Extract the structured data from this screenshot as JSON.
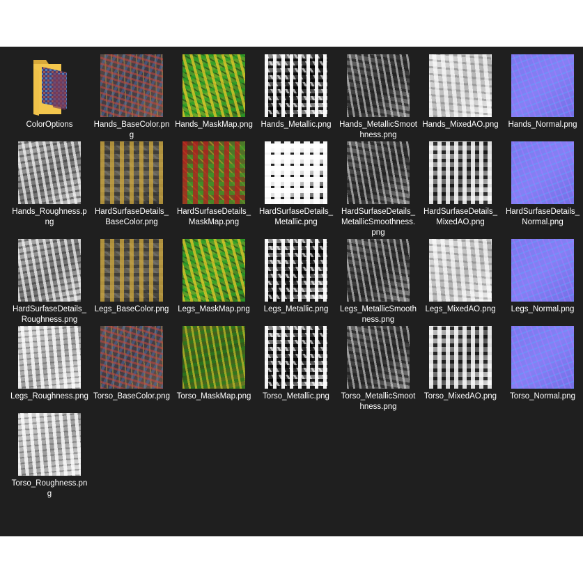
{
  "window": {
    "background": "#1f1f1f",
    "text_color": "#ffffff"
  },
  "folder": {
    "label": "ColorOptions",
    "icon": "folder-icon",
    "color": "#f3c64d"
  },
  "files": [
    {
      "label": "Hands_BaseColor.png",
      "style": "tx-base"
    },
    {
      "label": "Hands_MaskMap.png",
      "style": "tx-mask-green"
    },
    {
      "label": "Hands_Metallic.png",
      "style": "tx-metal"
    },
    {
      "label": "Hands_MetallicSmoothness.png",
      "style": "tx-smooth"
    },
    {
      "label": "Hands_MixedAO.png",
      "style": "tx-ao"
    },
    {
      "label": "Hands_Normal.png",
      "style": "tx-normal"
    },
    {
      "label": "Hands_Roughness.png",
      "style": "tx-rough"
    },
    {
      "label": "HardSurfaseDetails_BaseColor.png",
      "style": "tx-base-yellow"
    },
    {
      "label": "HardSurfaseDetails_MaskMap.png",
      "style": "tx-mask-red"
    },
    {
      "label": "HardSurfaseDetails_Metallic.png",
      "style": "tx-metal-bright"
    },
    {
      "label": "HardSurfaseDetails_MetallicSmoothness.png",
      "style": "tx-smooth"
    },
    {
      "label": "HardSurfaseDetails_MixedAO.png",
      "style": "tx-ao-dark"
    },
    {
      "label": "HardSurfaseDetails_Normal.png",
      "style": "tx-normal"
    },
    {
      "label": "HardSurfaseDetails_Roughness.png",
      "style": "tx-rough"
    },
    {
      "label": "Legs_BaseColor.png",
      "style": "tx-base-yellow"
    },
    {
      "label": "Legs_MaskMap.png",
      "style": "tx-mask-green"
    },
    {
      "label": "Legs_Metallic.png",
      "style": "tx-metal"
    },
    {
      "label": "Legs_MetallicSmoothness.png",
      "style": "tx-smooth"
    },
    {
      "label": "Legs_MixedAO.png",
      "style": "tx-ao"
    },
    {
      "label": "Legs_Normal.png",
      "style": "tx-normal"
    },
    {
      "label": "Legs_Roughness.png",
      "style": "tx-rough-light"
    },
    {
      "label": "Torso_BaseColor.png",
      "style": "tx-base"
    },
    {
      "label": "Torso_MaskMap.png",
      "style": "tx-mask-olive"
    },
    {
      "label": "Torso_Metallic.png",
      "style": "tx-metal"
    },
    {
      "label": "Torso_MetallicSmoothness.png",
      "style": "tx-smooth"
    },
    {
      "label": "Torso_MixedAO.png",
      "style": "tx-ao-dark"
    },
    {
      "label": "Torso_Normal.png",
      "style": "tx-normal"
    },
    {
      "label": "Torso_Roughness.png",
      "style": "tx-rough-light"
    }
  ]
}
